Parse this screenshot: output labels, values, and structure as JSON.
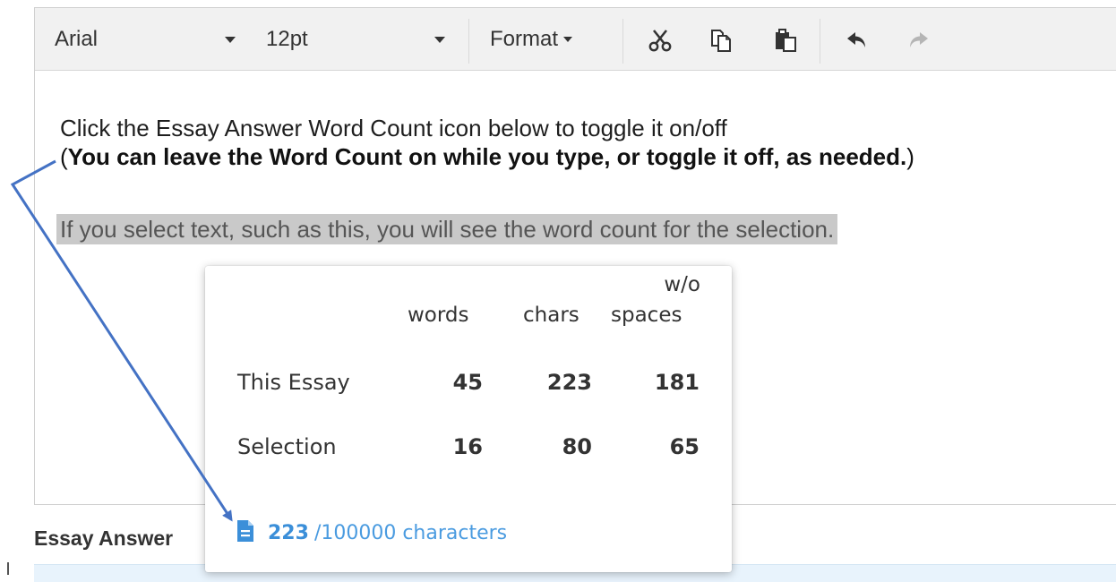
{
  "toolbar": {
    "font_family": "Arial",
    "font_size": "12pt",
    "format_label": "Format",
    "icons": [
      "cut-icon",
      "copy-icon",
      "paste-icon",
      "undo-icon",
      "redo-icon"
    ]
  },
  "content": {
    "line1": "Click the Essay Answer Word Count icon below to toggle it on/off",
    "line2_open": "(",
    "line2_bold": "You can leave the Word Count on while you type, or toggle it off, as needed.",
    "line2_close": ")",
    "line3": "If you select text, such as this, you will see the word count for the selection."
  },
  "word_count_popup": {
    "headers": {
      "words": "words",
      "chars": "chars",
      "wo_top": "w/o",
      "wo_bottom": "spaces"
    },
    "rows": [
      {
        "label": "This Essay",
        "words": "45",
        "chars": "223",
        "spaces": "181"
      },
      {
        "label": "Selection",
        "words": "16",
        "chars": "80",
        "spaces": "65"
      }
    ],
    "char_count": "223",
    "char_limit": "/100000 characters"
  },
  "footer": {
    "label": "Essay Answer"
  },
  "colors": {
    "accent": "#3b8fd9",
    "arrow": "#4472c4",
    "highlight": "#c9c9c9",
    "toolbar_bg": "#f1f1f1"
  }
}
